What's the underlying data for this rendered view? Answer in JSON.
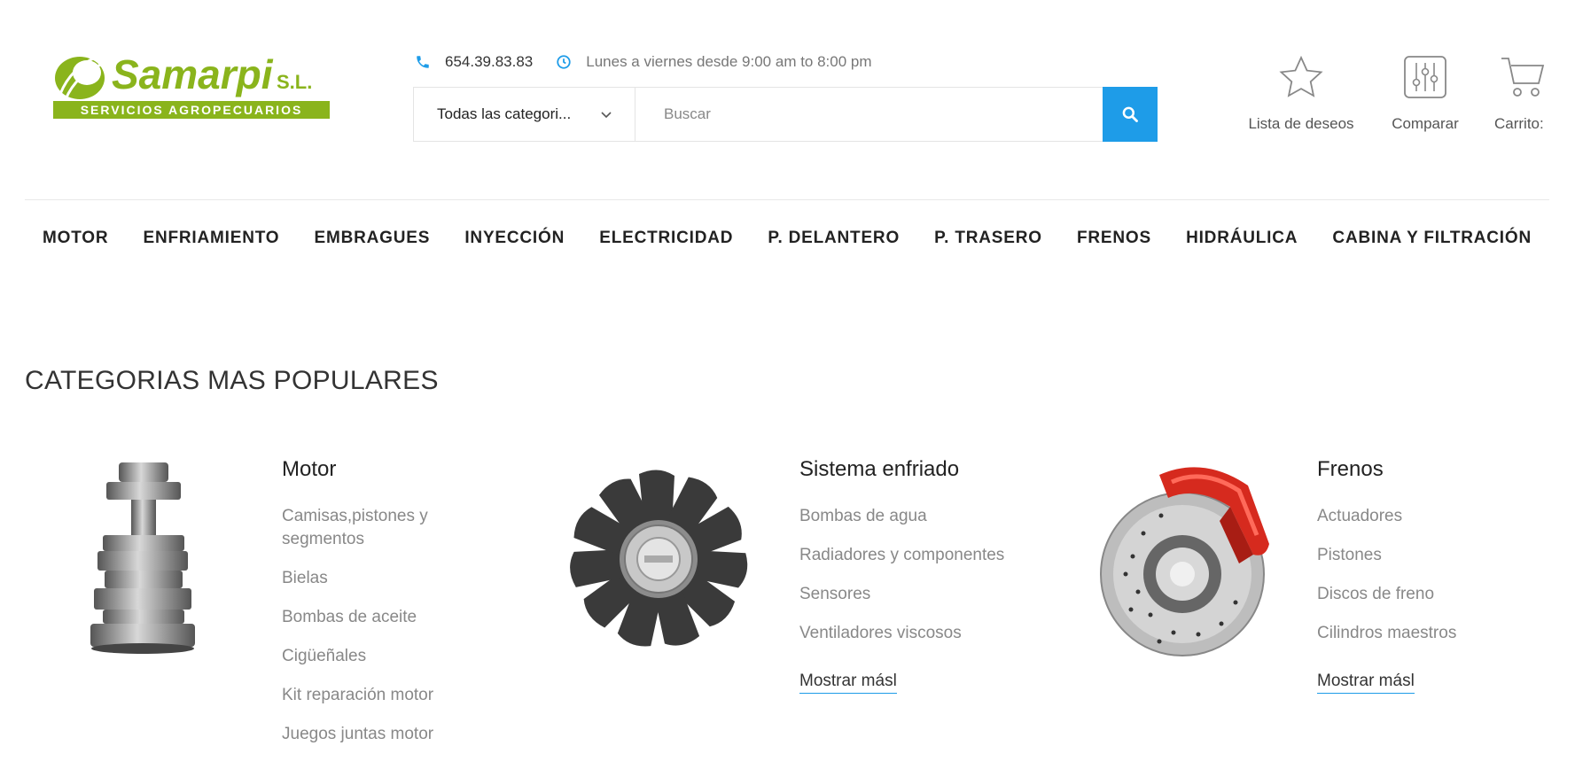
{
  "header": {
    "logo": {
      "brand": "Samarpi",
      "suffix": "S.L.",
      "tagline": "SERVICIOS AGROPECUARIOS"
    },
    "contact": {
      "phone": "654.39.83.83",
      "hours": "Lunes a viernes desde 9:00 am to 8:00 pm"
    },
    "search": {
      "category": "Todas las categori...",
      "placeholder": "Buscar"
    },
    "actions": {
      "wishlist": "Lista de deseos",
      "compare": "Comparar",
      "cart": "Carrito:"
    }
  },
  "nav": [
    "MOTOR",
    "ENFRIAMIENTO",
    "EMBRAGUES",
    "INYECCIÓN",
    "ELECTRICIDAD",
    "P. DELANTERO",
    "P. TRASERO",
    "FRENOS",
    "HIDRÁULICA",
    "CABINA Y FILTRACIÓN"
  ],
  "section": {
    "title": "CATEGORIAS MAS POPULARES"
  },
  "categories": [
    {
      "title": "Motor",
      "items": [
        "Camisas,pistones y segmentos",
        "Bielas",
        "Bombas de aceite",
        "Cigüeñales",
        "Kit reparación motor",
        "Juegos juntas motor"
      ]
    },
    {
      "title": "Sistema enfriado",
      "items": [
        "Bombas de agua",
        "Radiadores y componentes",
        "Sensores",
        "Ventiladores viscosos"
      ],
      "more": "Mostrar másl"
    },
    {
      "title": "Frenos",
      "items": [
        "Actuadores",
        "Pistones",
        "Discos de freno",
        "Cilindros maestros"
      ],
      "more": "Mostrar másl"
    }
  ],
  "colors": {
    "brand_green": "#8ab41c",
    "accent_blue": "#1e9ce8"
  }
}
